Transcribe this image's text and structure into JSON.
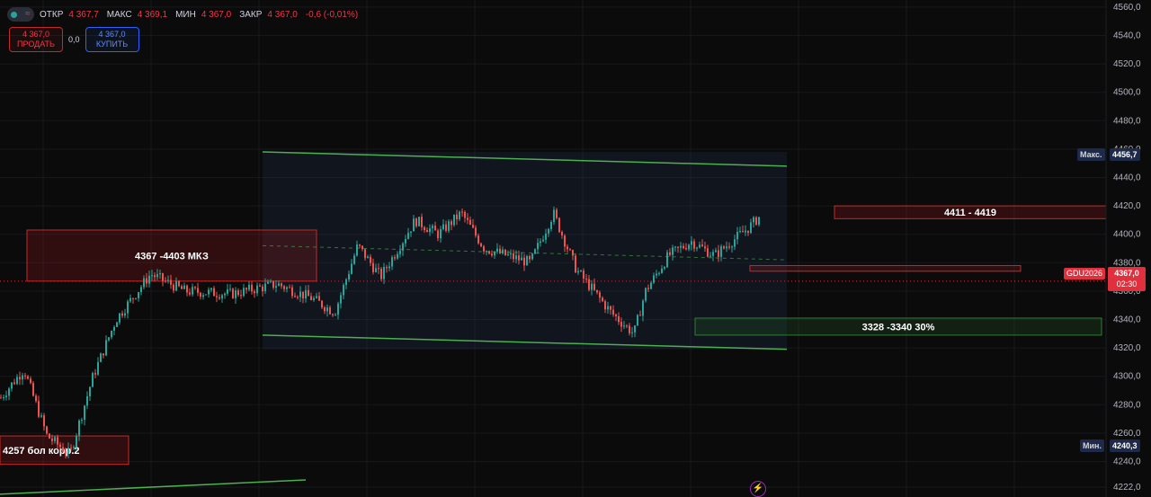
{
  "legend": {
    "open_label": "ОТКР",
    "open": "4 367,7",
    "high_label": "МАКС",
    "high": "4 369,1",
    "low_label": "МИН",
    "low": "4 367,0",
    "close_label": "ЗАКР",
    "close": "4 367,0",
    "change": "-0,6 (-0,01%)"
  },
  "trade": {
    "sell_price": "4 367,0",
    "sell_label": "ПРОДАТЬ",
    "spread": "0,0",
    "buy_price": "4 367,0",
    "buy_label": "КУПИТЬ"
  },
  "axis": {
    "max_tag_label": "Макс.",
    "max_tag_value": "4456,7",
    "min_tag_label": "Мин.",
    "min_tag_value": "4240,3",
    "symbol": "GDU2026",
    "last_price": "4367,0",
    "countdown": "02:30"
  },
  "colors": {
    "background": "#0b0b0c",
    "up": "#26a69a",
    "down": "#ef5350",
    "channel": "#4caf50",
    "resistance_zone": "#b71c1c",
    "support_zone": "#2e7d32"
  },
  "chart_data": {
    "type": "candlestick",
    "ylim": [
      4215,
      4565
    ],
    "y_ticks": [
      {
        "value": 4560,
        "label": "4560,0"
      },
      {
        "value": 4540,
        "label": "4540,0"
      },
      {
        "value": 4520,
        "label": "4520,0"
      },
      {
        "value": 4500,
        "label": "4500,0"
      },
      {
        "value": 4480,
        "label": "4480,0"
      },
      {
        "value": 4460,
        "label": "4460,0"
      },
      {
        "value": 4440,
        "label": "4440,0"
      },
      {
        "value": 4420,
        "label": "4420,0"
      },
      {
        "value": 4400,
        "label": "4400,0"
      },
      {
        "value": 4380,
        "label": "4380,0"
      },
      {
        "value": 4360,
        "label": "4360,0"
      },
      {
        "value": 4340,
        "label": "4340,0"
      },
      {
        "value": 4320,
        "label": "4320,0"
      },
      {
        "value": 4300,
        "label": "4300,0"
      },
      {
        "value": 4280,
        "label": "4280,0"
      },
      {
        "value": 4260,
        "label": "4260,0"
      },
      {
        "value": 4240,
        "label": "4240,0"
      },
      {
        "value": 4222,
        "label": "4222,0"
      }
    ],
    "price_path": [
      [
        0.0,
        4285
      ],
      [
        0.02,
        4305
      ],
      [
        0.04,
        4258
      ],
      [
        0.06,
        4245
      ],
      [
        0.08,
        4300
      ],
      [
        0.1,
        4340
      ],
      [
        0.13,
        4372
      ],
      [
        0.16,
        4360
      ],
      [
        0.2,
        4358
      ],
      [
        0.24,
        4365
      ],
      [
        0.27,
        4355
      ],
      [
        0.29,
        4345
      ],
      [
        0.31,
        4392
      ],
      [
        0.33,
        4370
      ],
      [
        0.36,
        4410
      ],
      [
        0.38,
        4400
      ],
      [
        0.4,
        4415
      ],
      [
        0.42,
        4390
      ],
      [
        0.44,
        4385
      ],
      [
        0.46,
        4380
      ],
      [
        0.48,
        4415
      ],
      [
        0.5,
        4375
      ],
      [
        0.53,
        4345
      ],
      [
        0.55,
        4330
      ],
      [
        0.56,
        4360
      ],
      [
        0.58,
        4385
      ],
      [
        0.6,
        4395
      ],
      [
        0.62,
        4385
      ],
      [
        0.65,
        4405
      ],
      [
        0.68,
        4430
      ],
      [
        0.7,
        4440
      ],
      [
        0.72,
        4410
      ],
      [
        0.74,
        4418
      ],
      [
        0.76,
        4395
      ],
      [
        0.78,
        4370
      ],
      [
        0.8,
        4345
      ],
      [
        0.82,
        4365
      ]
    ],
    "channel": {
      "upper": [
        [
          4458,
          4448
        ]
      ],
      "lower": [
        [
          4329,
          4319
        ]
      ],
      "mid_dashed": [
        [
          4392,
          4382
        ]
      ]
    },
    "lower_trendline": [
      [
        4217,
        4227
      ]
    ],
    "zones": [
      {
        "label": "4367 -4403 МКЗ",
        "top": 4403,
        "bottom": 4367,
        "kind": "resistance"
      },
      {
        "label": "4411 - 4419",
        "top": 4420,
        "bottom": 4411,
        "kind": "resistance"
      },
      {
        "label": "",
        "top": 4378,
        "bottom": 4374,
        "kind": "resistance"
      },
      {
        "label": "3328 -3340 30%",
        "top": 4341,
        "bottom": 4329,
        "kind": "support"
      },
      {
        "label": "4257 бол корр.2",
        "top": 4258,
        "bottom": 4238,
        "kind": "resistance"
      }
    ],
    "last_price": 4367.0,
    "high": 4456.7,
    "low": 4240.3
  }
}
